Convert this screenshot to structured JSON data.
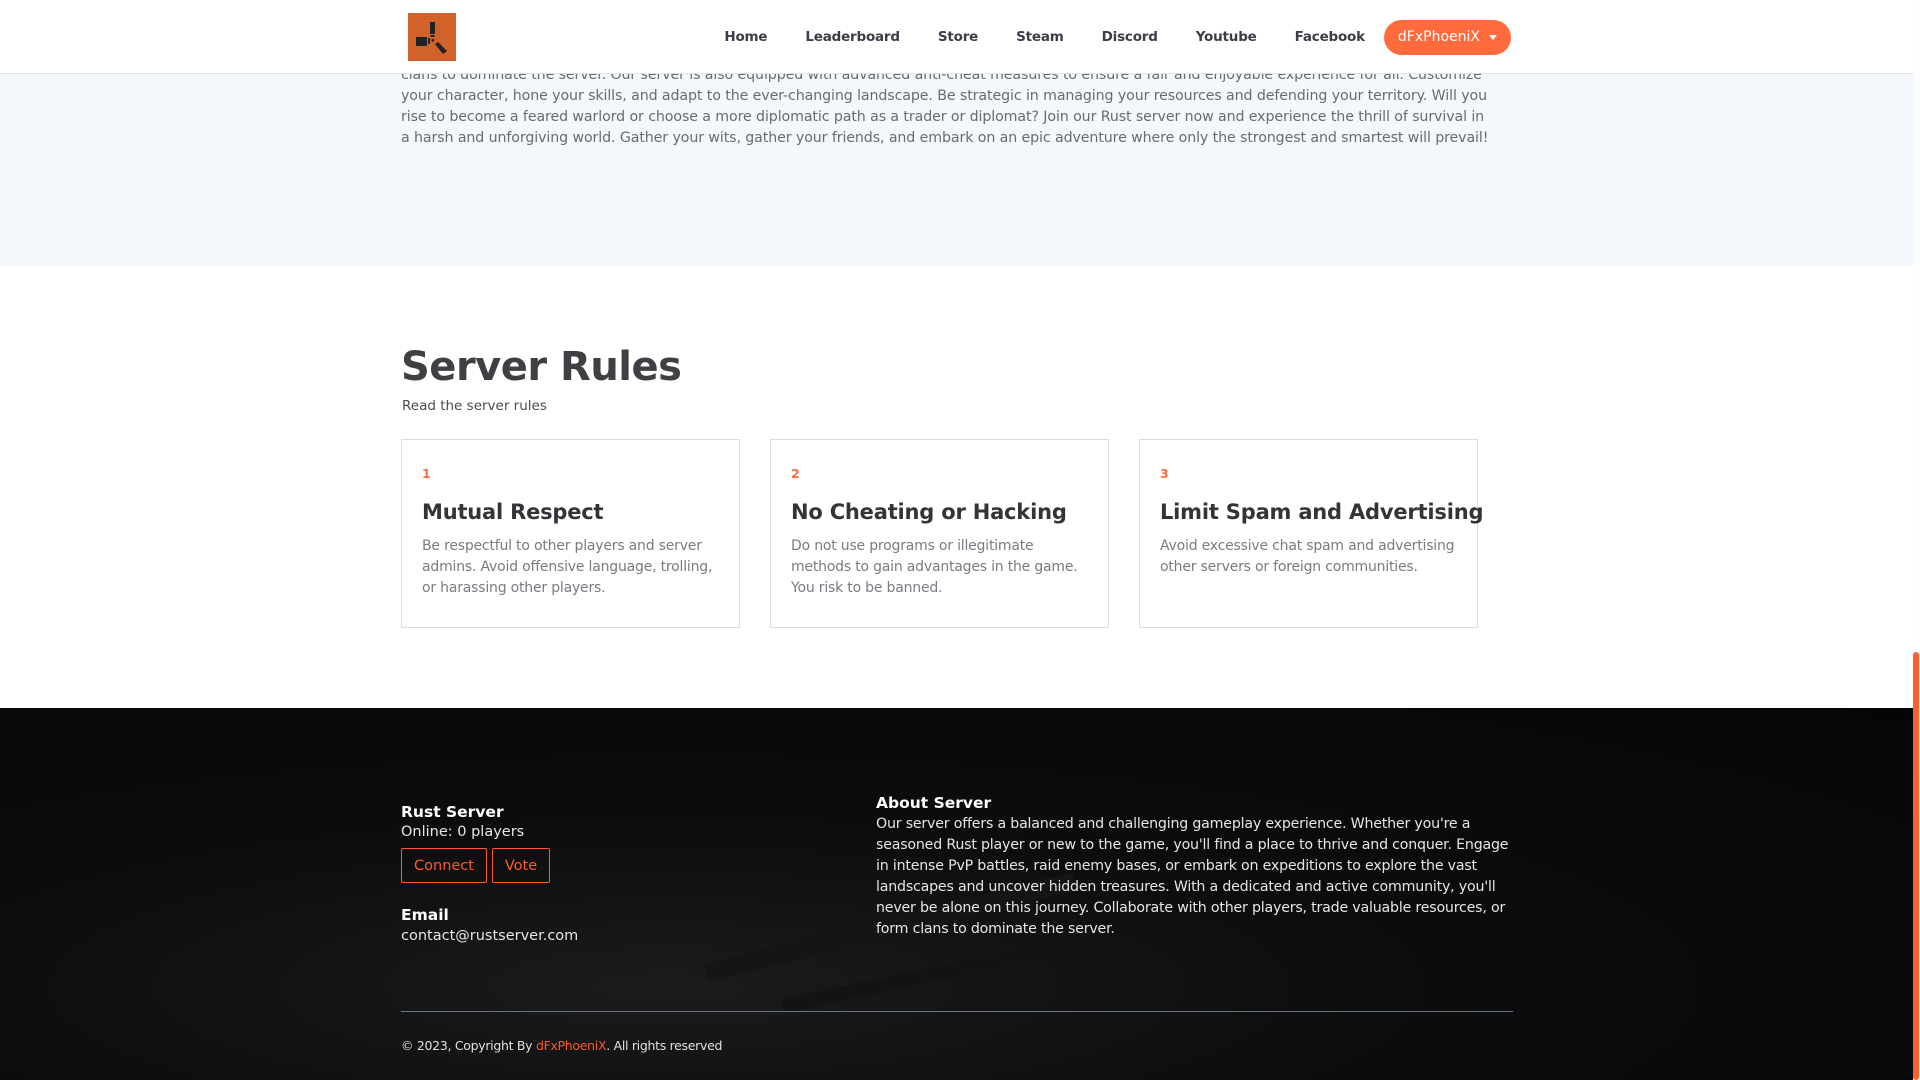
{
  "nav": {
    "logo": "rust-logo",
    "links": [
      "Home",
      "Leaderboard",
      "Store",
      "Steam",
      "Discord",
      "Youtube",
      "Facebook"
    ],
    "user_button": "dFxPhoeniX"
  },
  "intro": {
    "text": "clans to dominate the server. Our server is also equipped with advanced anti-cheat measures to ensure a fair and enjoyable experience for all. Customize your character, hone your skills, and adapt to the ever-changing landscape. Be strategic in managing your resources and defending your territory. Will you rise to become a feared warlord or choose a more diplomatic path as a trader or diplomat? Join our Rust server now and experience the thrill of survival in a harsh and unforgiving world. Gather your wits, gather your friends, and embark on an epic adventure where only the strongest and smartest will prevail!"
  },
  "rules": {
    "title": "Server Rules",
    "subtitle": "Read the server rules",
    "items": [
      {
        "number": "1",
        "title": "Mutual Respect",
        "description": "Be respectful to other players and server admins. Avoid offensive language, trolling, or harassing other players."
      },
      {
        "number": "2",
        "title": "No Cheating or Hacking",
        "description": "Do not use programs or illegitimate methods to gain advantages in the game. You risk to be banned."
      },
      {
        "number": "3",
        "title": "Limit Spam and Advertising",
        "description": "Avoid excessive chat spam and advertising other servers or foreign communities."
      }
    ]
  },
  "footer": {
    "server_heading": "Rust Server",
    "online_status": "Online: 0 players",
    "connect_label": "Connect",
    "vote_label": "Vote",
    "email_heading": "Email",
    "email": "contact@rustserver.com",
    "about_heading": "About Server",
    "about_text": "Our server offers a balanced and challenging gameplay experience. Whether you're a seasoned Rust player or new to the game, you'll find a place to thrive and conquer. Engage in intense PvP battles, raid enemy bases, or embark on expeditions to explore the vast landscapes and uncover hidden treasures. With a dedicated and active community, you'll never be alone on this journey. Collaborate with other players, trade valuable resources, or form clans to dominate the server.",
    "copyright_prefix": "© 2023, Copyright By ",
    "copyright_brand": "dFxPhoeniX",
    "copyright_suffix": ". All rights reserved"
  },
  "colors": {
    "accent": "#ff6b3d",
    "logo_bg": "#d0622a",
    "intro_bg": "#f4f7fb",
    "footer_bg": "#050505"
  }
}
